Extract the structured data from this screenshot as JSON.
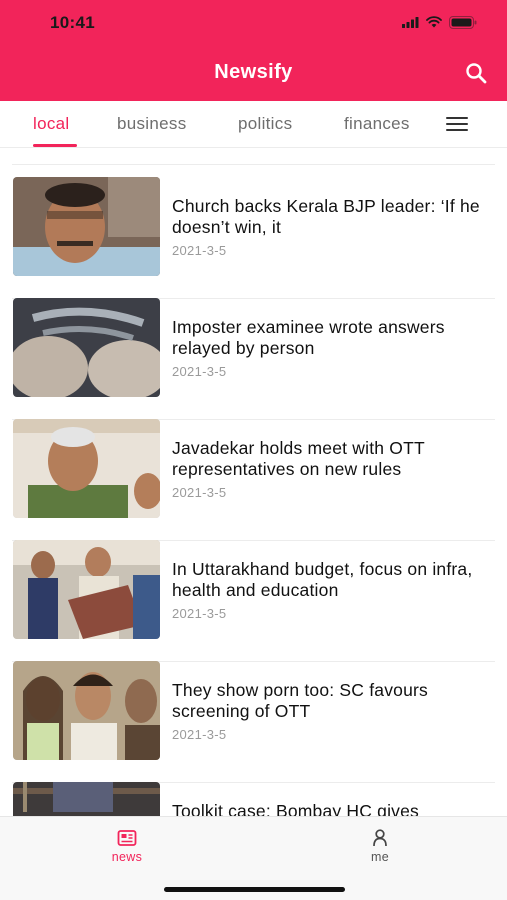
{
  "status": {
    "time": "10:41"
  },
  "header": {
    "title": "Newsify",
    "search_icon": "search-icon"
  },
  "tabs": [
    {
      "label": "local",
      "active": true
    },
    {
      "label": "business",
      "active": false
    },
    {
      "label": "politics",
      "active": false
    },
    {
      "label": "finances",
      "active": false
    }
  ],
  "menu_icon": "hamburger-menu-icon",
  "articles": [
    {
      "title": "Church backs Kerala BJP leader: ‘If he doesn’t win, it",
      "date": "2021-3-5"
    },
    {
      "title": "Imposter examinee wrote answers relayed by person",
      "date": "2021-3-5"
    },
    {
      "title": "Javadekar holds meet with OTT representatives on new rules",
      "date": "2021-3-5"
    },
    {
      "title": "In Uttarakhand budget, focus on infra, health and education",
      "date": "2021-3-5"
    },
    {
      "title": "They show porn too: SC favours screening of OTT",
      "date": "2021-3-5"
    },
    {
      "title": "Toolkit case: Bombay HC gives",
      "date": ""
    }
  ],
  "bottom_nav": [
    {
      "label": "news",
      "icon": "newspaper-icon",
      "active": true
    },
    {
      "label": "me",
      "icon": "person-icon",
      "active": false
    }
  ],
  "colors": {
    "accent": "#f2245a",
    "tab_inactive": "#6e6e6e",
    "date": "#9a9a9a"
  }
}
